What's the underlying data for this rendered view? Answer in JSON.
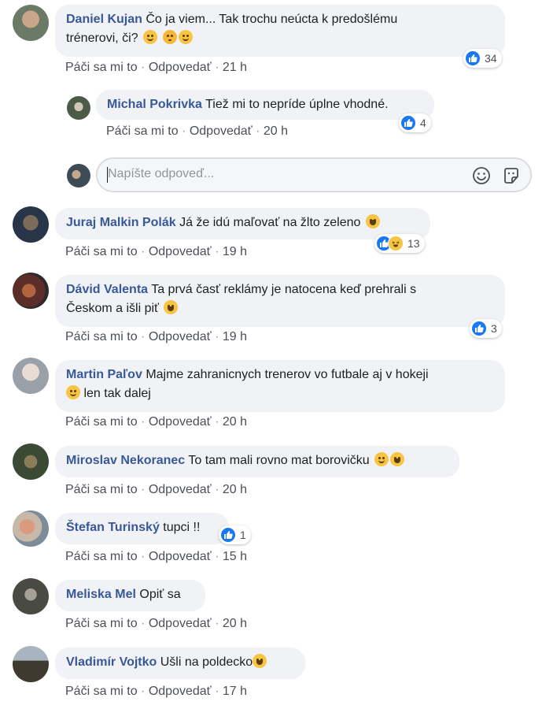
{
  "comments": [
    {
      "author": "Daniel Kujan",
      "text": "Čo ja viem... Tak trochu neúcta k predošlému",
      "text2": "trénerovi, či?",
      "actions": {
        "like": "Páči sa mi to",
        "reply": "Odpovedať",
        "time": "21 h"
      },
      "reactions": {
        "count": "34",
        "types": [
          "like"
        ]
      }
    },
    {
      "author": "Michal Pokrivka",
      "text": "Tiež mi to nepríde úplne vhodné.",
      "actions": {
        "like": "Páči sa mi to",
        "reply": "Odpovedať",
        "time": "20 h"
      },
      "reactions": {
        "count": "4",
        "types": [
          "like"
        ]
      }
    },
    {
      "author": "Juraj Malkin Polák",
      "text": "Já že idú maľovať na žlto zeleno",
      "actions": {
        "like": "Páči sa mi to",
        "reply": "Odpovedať",
        "time": "19 h"
      },
      "reactions": {
        "count": "13",
        "types": [
          "like",
          "haha"
        ]
      }
    },
    {
      "author": "Dávid Valenta",
      "text": "Ta prvá časť reklámy je natocena keď prehrali s",
      "text2": "Českom a išli piť",
      "actions": {
        "like": "Páči sa mi to",
        "reply": "Odpovedať",
        "time": "19 h"
      },
      "reactions": {
        "count": "3",
        "types": [
          "like"
        ]
      }
    },
    {
      "author": "Martin Paľov",
      "text": "Majme zahranicnych trenerov vo futbale aj v hokeji",
      "text2": "len tak dalej",
      "actions": {
        "like": "Páči sa mi to",
        "reply": "Odpovedať",
        "time": "20 h"
      }
    },
    {
      "author": "Miroslav Nekoranec",
      "text": "To tam mali rovno mat borovičku",
      "actions": {
        "like": "Páči sa mi to",
        "reply": "Odpovedať",
        "time": "20 h"
      }
    },
    {
      "author": "Štefan Turinský",
      "text": "tupci !!",
      "actions": {
        "like": "Páči sa mi to",
        "reply": "Odpovedať",
        "time": "15 h"
      },
      "reactions": {
        "count": "1",
        "types": [
          "like"
        ]
      }
    },
    {
      "author": "Meliska Mel",
      "text": "Opiť sa",
      "actions": {
        "like": "Páči sa mi to",
        "reply": "Odpovedať",
        "time": "20 h"
      }
    },
    {
      "author": "Vladimír Vojtko",
      "text": "Ušli na poldecko",
      "actions": {
        "like": "Páči sa mi to",
        "reply": "Odpovedať",
        "time": "17 h"
      }
    }
  ],
  "reply_box": {
    "placeholder": "Napíšte odpoveď...",
    "icons": [
      "smiley-icon",
      "sticker-icon"
    ]
  },
  "separator": "·",
  "colors": {
    "author": "#385898",
    "bubble": "#f0f2f5",
    "like": "#1877f2",
    "meta": "#4b4f56"
  }
}
